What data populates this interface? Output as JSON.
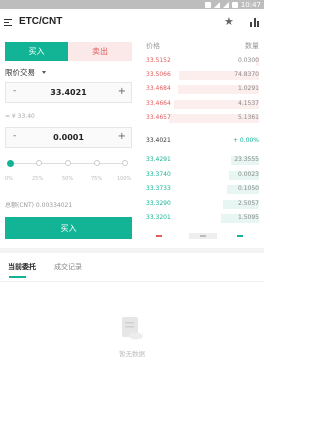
{
  "status_bar": {
    "time": "10:47"
  },
  "header": {
    "pair": "ETC/CNT"
  },
  "trade_tabs": {
    "buy": "买入",
    "sell": "卖出"
  },
  "order_type": {
    "selected": "限价交易"
  },
  "price_input": {
    "minus": "-",
    "value": "33.4021",
    "plus": "+"
  },
  "price_approx": "≈ ¥ 33.40",
  "amount_input": {
    "minus": "-",
    "value": "0.0001",
    "plus": "+"
  },
  "slider": {
    "value_percent": 0,
    "ticks": [
      "0%",
      "25%",
      "50%",
      "75%",
      "100%"
    ]
  },
  "total": "总额(CNT) 0.00334021",
  "buy_button": "买入",
  "order_book": {
    "price_header": "价格",
    "amount_header": "数量",
    "asks": [
      {
        "price": "33.5152",
        "amount": "0.0300"
      },
      {
        "price": "33.5066",
        "amount": "74.8370"
      },
      {
        "price": "33.4684",
        "amount": "1.0291"
      },
      {
        "price": "33.4664",
        "amount": "4.1537"
      },
      {
        "price": "33.4657",
        "amount": "5.1361"
      }
    ],
    "last_price": "33.4021",
    "change": "+ 0.00%",
    "bids": [
      {
        "price": "33.4291",
        "amount": "23.3555"
      },
      {
        "price": "33.3740",
        "amount": "0.0023"
      },
      {
        "price": "33.3733",
        "amount": "0.1050"
      },
      {
        "price": "33.3290",
        "amount": "2.5057"
      },
      {
        "price": "33.3201",
        "amount": "1.5095"
      }
    ]
  },
  "orders": {
    "tabs": [
      "当前委托",
      "成交记录"
    ],
    "empty_text": "暂无数据"
  },
  "colors": {
    "accent": "#13b496",
    "sell": "#e35b5b"
  }
}
